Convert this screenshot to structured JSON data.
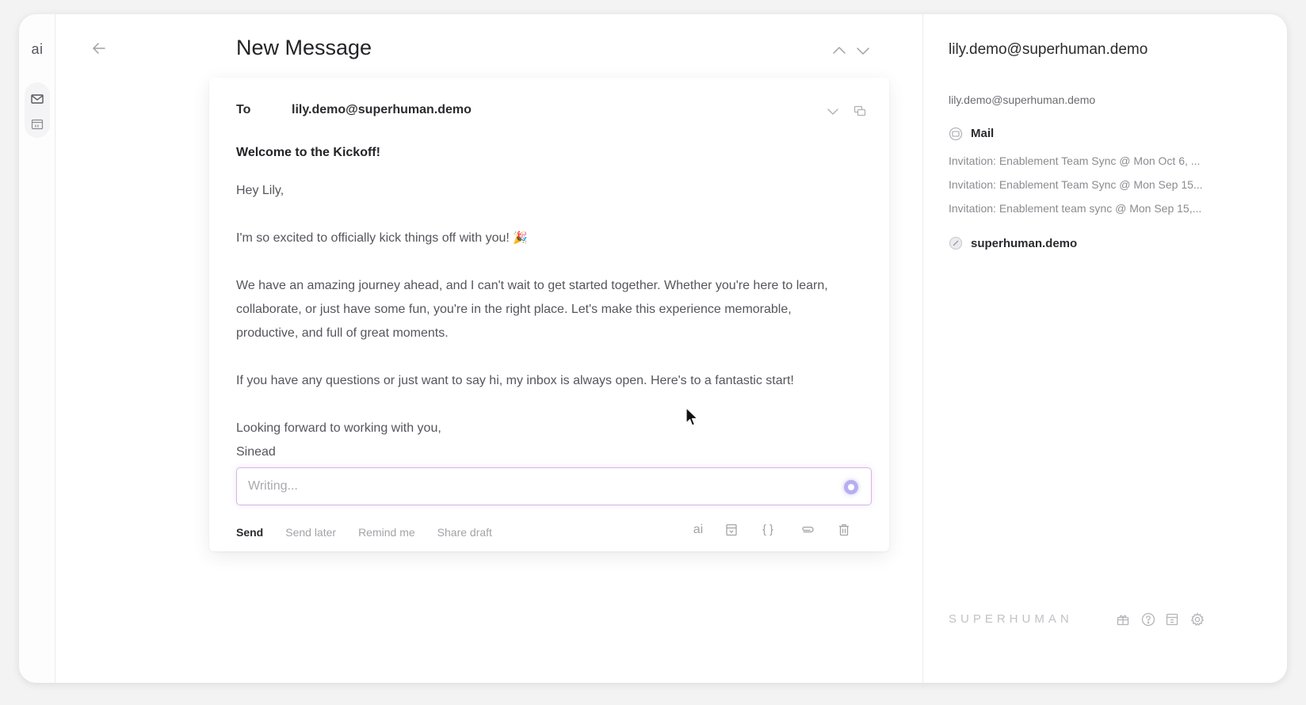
{
  "rail": {
    "ai_label": "ai",
    "icons": [
      "mail-icon",
      "calendar-icon"
    ]
  },
  "header": {
    "title": "New Message"
  },
  "compose": {
    "to_label": "To",
    "to_value": "lily.demo@superhuman.demo",
    "subject": "Welcome to the Kickoff!",
    "body": {
      "greeting": "Hey Lily,",
      "line1": "I'm so excited to officially kick things off with you!",
      "emoji": "🎉",
      "para2": "We have an amazing journey ahead, and I can't wait to get started together. Whether you're here to learn, collaborate, or just have some fun, you're in the right place. Let's make this experience memorable, productive, and full of great moments.",
      "para3": "If you have any questions or just want to say hi, my inbox is always open. Here's to a fantastic start!",
      "closing": "Looking forward to working with you,",
      "signature": "Sinead"
    },
    "ai_input_placeholder": "Writing...",
    "actions": {
      "send": "Send",
      "send_later": "Send later",
      "remind_me": "Remind me",
      "share_draft": "Share draft"
    },
    "tools": {
      "ai": "ai"
    }
  },
  "panel": {
    "title": "lily.demo@superhuman.demo",
    "subtitle": "lily.demo@superhuman.demo",
    "mail_label": "Mail",
    "mail_items": [
      "Invitation: Enablement Team Sync @ Mon Oct 6, ...",
      "Invitation: Enablement Team Sync @ Mon Sep 15...",
      "Invitation: Enablement team sync @ Mon Sep 15,..."
    ],
    "domain_label": "superhuman.demo",
    "brand": "SUPERHUMAN"
  },
  "colors": {
    "accent_border": "#d7b3e8",
    "ai_dot": "#b6aef0",
    "muted_text": "#a3a3a8"
  }
}
